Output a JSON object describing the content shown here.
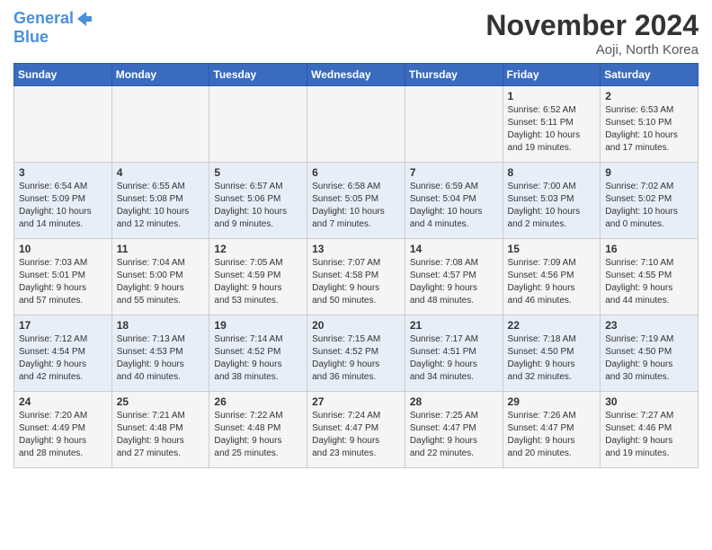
{
  "logo": {
    "line1": "General",
    "line2": "Blue"
  },
  "title": "November 2024",
  "location": "Aoji, North Korea",
  "weekdays": [
    "Sunday",
    "Monday",
    "Tuesday",
    "Wednesday",
    "Thursday",
    "Friday",
    "Saturday"
  ],
  "weeks": [
    [
      {
        "day": "",
        "info": ""
      },
      {
        "day": "",
        "info": ""
      },
      {
        "day": "",
        "info": ""
      },
      {
        "day": "",
        "info": ""
      },
      {
        "day": "",
        "info": ""
      },
      {
        "day": "1",
        "info": "Sunrise: 6:52 AM\nSunset: 5:11 PM\nDaylight: 10 hours\nand 19 minutes."
      },
      {
        "day": "2",
        "info": "Sunrise: 6:53 AM\nSunset: 5:10 PM\nDaylight: 10 hours\nand 17 minutes."
      }
    ],
    [
      {
        "day": "3",
        "info": "Sunrise: 6:54 AM\nSunset: 5:09 PM\nDaylight: 10 hours\nand 14 minutes."
      },
      {
        "day": "4",
        "info": "Sunrise: 6:55 AM\nSunset: 5:08 PM\nDaylight: 10 hours\nand 12 minutes."
      },
      {
        "day": "5",
        "info": "Sunrise: 6:57 AM\nSunset: 5:06 PM\nDaylight: 10 hours\nand 9 minutes."
      },
      {
        "day": "6",
        "info": "Sunrise: 6:58 AM\nSunset: 5:05 PM\nDaylight: 10 hours\nand 7 minutes."
      },
      {
        "day": "7",
        "info": "Sunrise: 6:59 AM\nSunset: 5:04 PM\nDaylight: 10 hours\nand 4 minutes."
      },
      {
        "day": "8",
        "info": "Sunrise: 7:00 AM\nSunset: 5:03 PM\nDaylight: 10 hours\nand 2 minutes."
      },
      {
        "day": "9",
        "info": "Sunrise: 7:02 AM\nSunset: 5:02 PM\nDaylight: 10 hours\nand 0 minutes."
      }
    ],
    [
      {
        "day": "10",
        "info": "Sunrise: 7:03 AM\nSunset: 5:01 PM\nDaylight: 9 hours\nand 57 minutes."
      },
      {
        "day": "11",
        "info": "Sunrise: 7:04 AM\nSunset: 5:00 PM\nDaylight: 9 hours\nand 55 minutes."
      },
      {
        "day": "12",
        "info": "Sunrise: 7:05 AM\nSunset: 4:59 PM\nDaylight: 9 hours\nand 53 minutes."
      },
      {
        "day": "13",
        "info": "Sunrise: 7:07 AM\nSunset: 4:58 PM\nDaylight: 9 hours\nand 50 minutes."
      },
      {
        "day": "14",
        "info": "Sunrise: 7:08 AM\nSunset: 4:57 PM\nDaylight: 9 hours\nand 48 minutes."
      },
      {
        "day": "15",
        "info": "Sunrise: 7:09 AM\nSunset: 4:56 PM\nDaylight: 9 hours\nand 46 minutes."
      },
      {
        "day": "16",
        "info": "Sunrise: 7:10 AM\nSunset: 4:55 PM\nDaylight: 9 hours\nand 44 minutes."
      }
    ],
    [
      {
        "day": "17",
        "info": "Sunrise: 7:12 AM\nSunset: 4:54 PM\nDaylight: 9 hours\nand 42 minutes."
      },
      {
        "day": "18",
        "info": "Sunrise: 7:13 AM\nSunset: 4:53 PM\nDaylight: 9 hours\nand 40 minutes."
      },
      {
        "day": "19",
        "info": "Sunrise: 7:14 AM\nSunset: 4:52 PM\nDaylight: 9 hours\nand 38 minutes."
      },
      {
        "day": "20",
        "info": "Sunrise: 7:15 AM\nSunset: 4:52 PM\nDaylight: 9 hours\nand 36 minutes."
      },
      {
        "day": "21",
        "info": "Sunrise: 7:17 AM\nSunset: 4:51 PM\nDaylight: 9 hours\nand 34 minutes."
      },
      {
        "day": "22",
        "info": "Sunrise: 7:18 AM\nSunset: 4:50 PM\nDaylight: 9 hours\nand 32 minutes."
      },
      {
        "day": "23",
        "info": "Sunrise: 7:19 AM\nSunset: 4:50 PM\nDaylight: 9 hours\nand 30 minutes."
      }
    ],
    [
      {
        "day": "24",
        "info": "Sunrise: 7:20 AM\nSunset: 4:49 PM\nDaylight: 9 hours\nand 28 minutes."
      },
      {
        "day": "25",
        "info": "Sunrise: 7:21 AM\nSunset: 4:48 PM\nDaylight: 9 hours\nand 27 minutes."
      },
      {
        "day": "26",
        "info": "Sunrise: 7:22 AM\nSunset: 4:48 PM\nDaylight: 9 hours\nand 25 minutes."
      },
      {
        "day": "27",
        "info": "Sunrise: 7:24 AM\nSunset: 4:47 PM\nDaylight: 9 hours\nand 23 minutes."
      },
      {
        "day": "28",
        "info": "Sunrise: 7:25 AM\nSunset: 4:47 PM\nDaylight: 9 hours\nand 22 minutes."
      },
      {
        "day": "29",
        "info": "Sunrise: 7:26 AM\nSunset: 4:47 PM\nDaylight: 9 hours\nand 20 minutes."
      },
      {
        "day": "30",
        "info": "Sunrise: 7:27 AM\nSunset: 4:46 PM\nDaylight: 9 hours\nand 19 minutes."
      }
    ]
  ]
}
